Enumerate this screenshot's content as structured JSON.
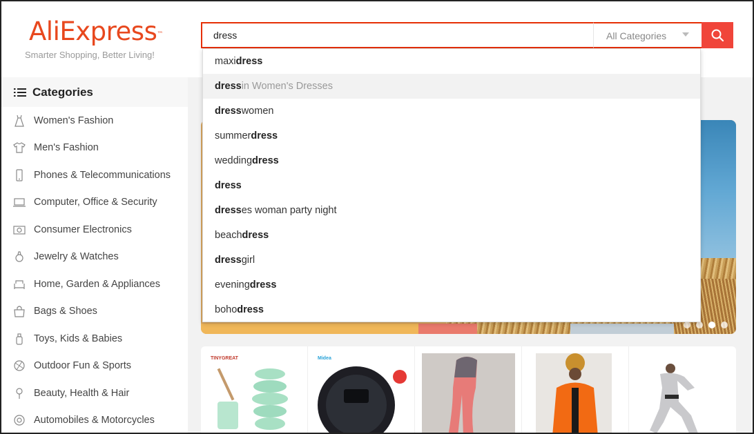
{
  "header": {
    "logo_text": "AliExpress",
    "logo_tm": "™",
    "tagline": "Smarter Shopping, Better Living!"
  },
  "search": {
    "value": "dress",
    "category_label": "All Categories"
  },
  "sidebar": {
    "title": "Categories",
    "items": [
      {
        "label": "Women's Fashion",
        "icon": "dress-icon"
      },
      {
        "label": "Men's Fashion",
        "icon": "shirt-icon"
      },
      {
        "label": "Phones & Telecommunications",
        "icon": "phone-icon"
      },
      {
        "label": "Computer, Office & Security",
        "icon": "laptop-icon"
      },
      {
        "label": "Consumer Electronics",
        "icon": "camera-icon"
      },
      {
        "label": "Jewelry & Watches",
        "icon": "ring-icon"
      },
      {
        "label": "Home, Garden & Appliances",
        "icon": "sofa-icon"
      },
      {
        "label": "Bags & Shoes",
        "icon": "bag-icon"
      },
      {
        "label": "Toys, Kids & Babies",
        "icon": "bottle-icon"
      },
      {
        "label": "Outdoor Fun & Sports",
        "icon": "ball-icon"
      },
      {
        "label": "Beauty, Health & Hair",
        "icon": "brush-icon"
      },
      {
        "label": "Automobiles & Motorcycles",
        "icon": "wheel-icon"
      }
    ]
  },
  "suggestions": [
    {
      "pre": "maxi ",
      "bold": "dress",
      "post": "",
      "muted": ""
    },
    {
      "pre": "",
      "bold": "dress",
      "post": "",
      "muted": " in Women's Dresses"
    },
    {
      "pre": "",
      "bold": "dress",
      "post": " women",
      "muted": ""
    },
    {
      "pre": "summer ",
      "bold": "dress",
      "post": "",
      "muted": ""
    },
    {
      "pre": "wedding ",
      "bold": "dress",
      "post": "",
      "muted": ""
    },
    {
      "pre": "",
      "bold": "dress",
      "post": "",
      "muted": ""
    },
    {
      "pre": "",
      "bold": "dress",
      "post": "es woman party night",
      "muted": ""
    },
    {
      "pre": "beach ",
      "bold": "dress",
      "post": "",
      "muted": ""
    },
    {
      "pre": "",
      "bold": "dress",
      "post": " girl",
      "muted": ""
    },
    {
      "pre": "evening ",
      "bold": "dress",
      "post": "",
      "muted": ""
    },
    {
      "pre": "boho ",
      "bold": "dress",
      "post": "",
      "muted": ""
    }
  ],
  "highlighted_index": 1,
  "products": [
    {
      "brand": "TINYGREAT"
    },
    {
      "brand": "Midea"
    },
    {
      "brand": ""
    },
    {
      "brand": ""
    },
    {
      "brand": ""
    }
  ],
  "colors": {
    "accent": "#e62e04",
    "search_button": "#f0453a",
    "logo": "#e8481e"
  }
}
